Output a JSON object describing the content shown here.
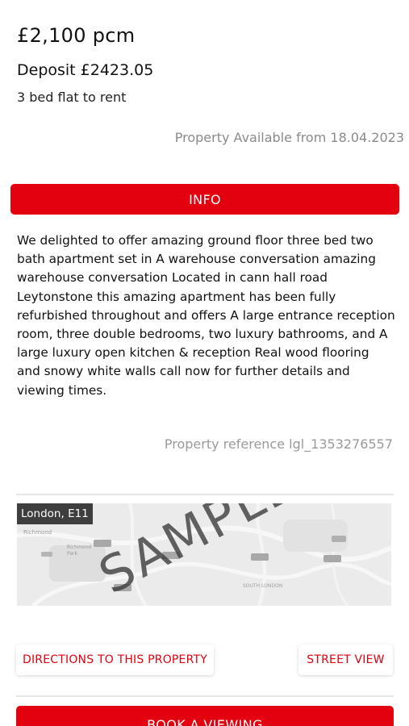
{
  "listing": {
    "price": "£2,100 pcm",
    "deposit": "Deposit £2423.05",
    "type": "3 bed flat to rent",
    "available": "Property Available from 18.04.2023",
    "reference": "Property reference lgl_1353276557"
  },
  "info_tab": {
    "label": "INFO"
  },
  "description": "We delighted to offer amazing ground floor three bed two bath apartment set in A warehouse conversation amazing warehouse conversation Located in cann hall road Leytonstone this amazing apartment has been fully refurbished throughout and offers A large entrance reception room, three double bedrooms, two luxury bathrooms, and A large luxury open kitchen & reception Real wood flooring and snowy white walls call now for further details and viewing times.",
  "map": {
    "location_label": "London, E11",
    "watermark": "SAMPLE"
  },
  "actions": {
    "directions": "DIRECTIONS TO THIS PROPERTY",
    "street_view": "STREET VIEW",
    "book_viewing": "BOOK A VIEWING"
  },
  "colors": {
    "accent": "#e3000f",
    "muted_text": "#8a8a8a",
    "map_label_bg": "#3e3e3e"
  }
}
